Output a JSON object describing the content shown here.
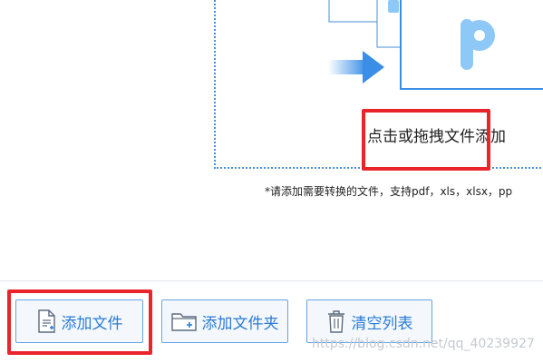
{
  "drop_zone": {
    "label": "点击或拖拽文件添加",
    "hint": "*请添加需要转换的文件，支持pdf，xls，xlsx，pp"
  },
  "toolbar": {
    "add_file_label": "添加文件",
    "add_folder_label": "添加文件夹",
    "clear_list_label": "清空列表"
  },
  "watermark": "https://blog.csdn.net/qq_40239927",
  "colors": {
    "accent": "#2b7bd4",
    "border": "#66a4e6",
    "highlight": "#e9242b",
    "logo": "#8dc8f7"
  },
  "icons": {
    "arrow": "arrow-right-icon",
    "logo": "letter-p-logo-icon",
    "add_file": "file-add-icon",
    "add_folder": "folder-add-icon",
    "clear": "trash-icon"
  }
}
